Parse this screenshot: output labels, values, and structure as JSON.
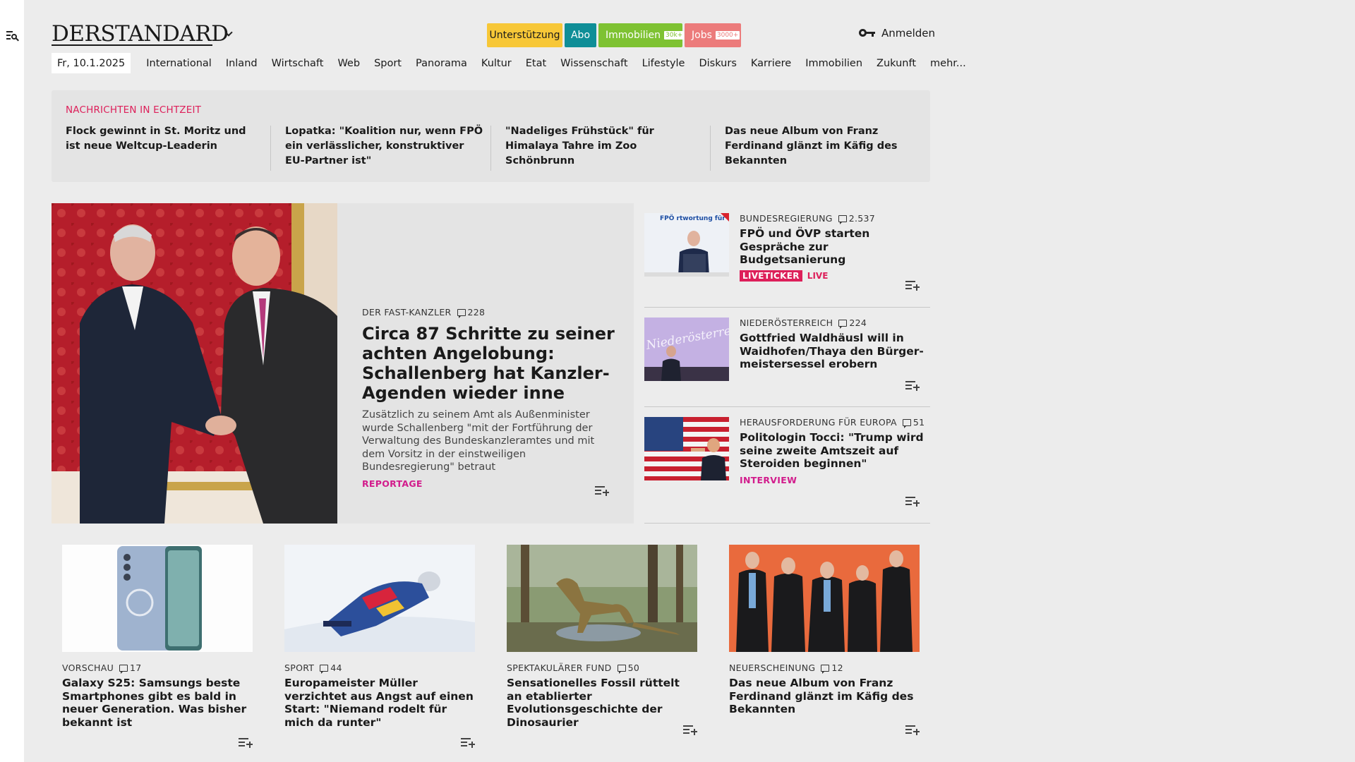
{
  "header": {
    "logo_text": "DERSTANDARD",
    "pills": {
      "support": "Unterstützung",
      "abo": "Abo",
      "immobilien": "Immobilien",
      "immobilien_badge": "30k+",
      "jobs": "Jobs",
      "jobs_badge": "3000+"
    },
    "login_label": "Anmelden"
  },
  "nav": {
    "date": "Fr, 10.1.2025",
    "items": [
      "International",
      "Inland",
      "Wirtschaft",
      "Web",
      "Sport",
      "Panorama",
      "Kultur",
      "Etat",
      "Wissenschaft",
      "Lifestyle",
      "Diskurs",
      "Karriere",
      "Immobilien",
      "Zukunft",
      "mehr..."
    ]
  },
  "ticker": {
    "label": "NACHRICHTEN IN ECHTZEIT",
    "items": [
      "Flock gewinnt in St. Moritz und ist neue Weltcup-Leaderin",
      "Lopatka: \"Koalition nur, wenn FPÖ ein verlässlicher, konstruktiver EU-Part­ner ist\"",
      "\"Nadeliges Frühstück\" für Himalaya Tahre im Zoo Schönbrunn",
      "Das neue Album von Franz Ferdinand glänzt im Käfig des Bekannten"
    ]
  },
  "lead": {
    "kicker": "DER FAST-KANZLER",
    "comments": "228",
    "title": "Circa 87 Schritte zu seiner achten Angelobung: Schallenberg hat Kanzler-Agenden wieder inne",
    "teaser": "Zusätzlich zu seinem Amt als Außenminister wurde Schallenberg \"mit der Fortführung der Verwaltung des Bundeskanzleramtes und mit dem Vorsitz in der einstweiligen Bundesregierung\" betraut",
    "tag": "REPORTAGE"
  },
  "side": [
    {
      "kicker": "BUNDESREGIERUNG",
      "comments": "2.537",
      "title": "FPÖ und ÖVP starten Gespräche zur Budgetsanierung",
      "badge": "LIVETICKER",
      "live": "LIVE",
      "image_text": "FPÖ  rtwortung für Österreich"
    },
    {
      "kicker": "NIEDERÖSTERREICH",
      "comments": "224",
      "title": "Gottfried Waldhäusl will in Waidhofen/Thaya den Bürger­meistersessel erobern",
      "image_text": "Niederösterreich"
    },
    {
      "kicker": "HERAUSFORDERUNG FÜR EUROPA",
      "comments": "51",
      "title": "Politologin Tocci: \"Trump wird seine zweite Amtszeit auf Steroiden beginnen\"",
      "tag": "INTERVIEW"
    }
  ],
  "cards": [
    {
      "kicker": "VORSCHAU",
      "comments": "17",
      "title": "Galaxy S25: Samsungs beste Smartphones gibt es bald in neuer Generation. Was bisher bekannt ist"
    },
    {
      "kicker": "SPORT",
      "comments": "44",
      "title": "Europameister Müller verzichtet aus Angst auf einen Start: \"Niemand rodelt für mich da runter\""
    },
    {
      "kicker": "SPEKTAKULÄRER FUND",
      "comments": "50",
      "title": "Sensationelles Fossil rüttelt an etablierter Evolutionsgeschichte der Dinosaurier"
    },
    {
      "kicker": "NEUERSCHEINUNG",
      "comments": "12",
      "title": "Das neue Album von Franz Ferdinand glänzt im Käfig des Bekannten"
    }
  ],
  "colors": {
    "accent_red": "#dd1f5a",
    "magenta": "#d21c8c",
    "support": "#f7c737",
    "abo": "#0f8e97",
    "immobilien": "#7ec232",
    "jobs": "#ec7b7b"
  }
}
